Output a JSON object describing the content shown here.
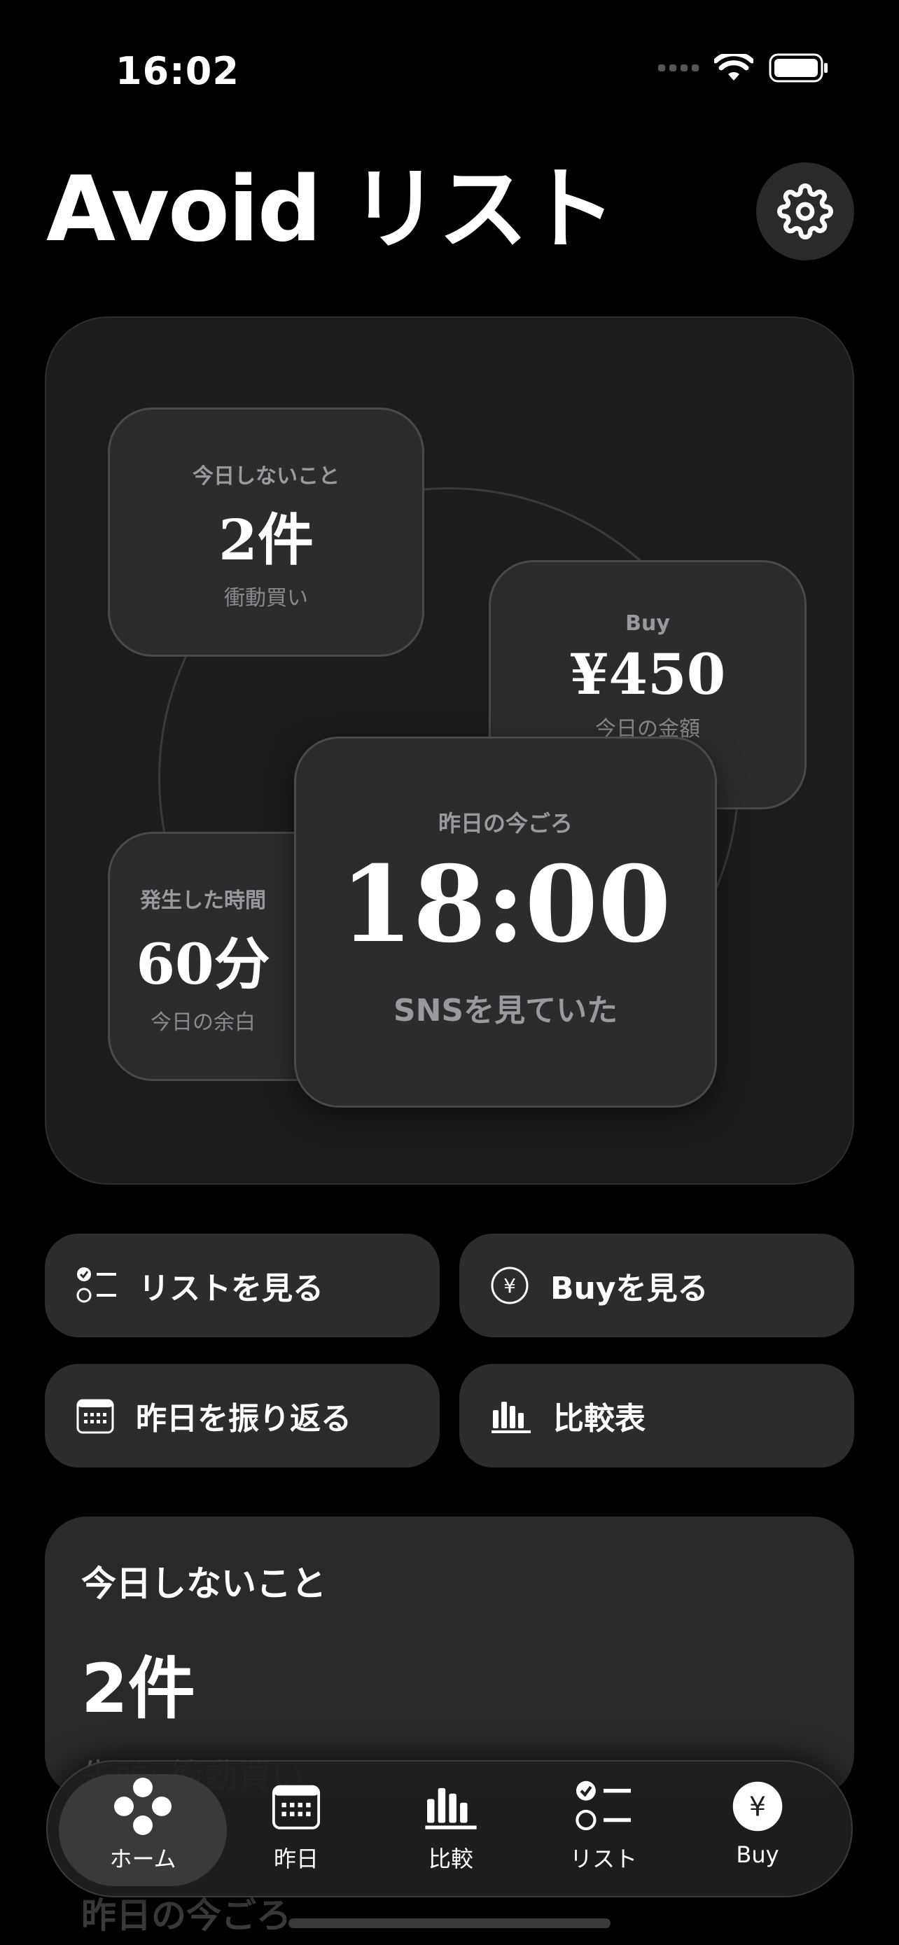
{
  "status_bar": {
    "time": "16:02",
    "icons": [
      "cellular-dots-icon",
      "wifi-icon",
      "battery-icon"
    ]
  },
  "header": {
    "title": "Avoid リスト",
    "settings_icon": "gear-icon"
  },
  "hero": {
    "today_card": {
      "label": "今日しないこと",
      "value": "2件",
      "sub": "衝動買い"
    },
    "buy_card": {
      "label": "Buy",
      "value": "¥450",
      "sub": "今日の金額"
    },
    "time_card": {
      "label": "発生した時間",
      "value": "60分",
      "sub": "今日の余白"
    },
    "yesterday_card": {
      "label": "昨日の今ごろ",
      "value": "18:00",
      "sub": "SNSを見ていた"
    }
  },
  "actions": [
    {
      "label": "リストを見る",
      "icon": "checklist-icon"
    },
    {
      "label": "Buyを見る",
      "icon": "yen-circle-icon"
    },
    {
      "label": "昨日を振り返る",
      "icon": "calendar-icon"
    },
    {
      "label": "比較表",
      "icon": "bar-chart-icon"
    }
  ],
  "summary": {
    "label": "今日しないこと",
    "value": "2件",
    "sub": "先頭: 衝動買い"
  },
  "next_section_label": "昨日の今ごろ",
  "tab_bar": {
    "tabs": [
      {
        "label": "ホーム",
        "icon": "home-dots-icon",
        "active": true
      },
      {
        "label": "昨日",
        "icon": "calendar-icon",
        "active": false
      },
      {
        "label": "比較",
        "icon": "bar-chart-icon",
        "active": false
      },
      {
        "label": "リスト",
        "icon": "checklist-icon",
        "active": false
      },
      {
        "label": "Buy",
        "icon": "yen-circle-icon",
        "active": false
      }
    ]
  }
}
